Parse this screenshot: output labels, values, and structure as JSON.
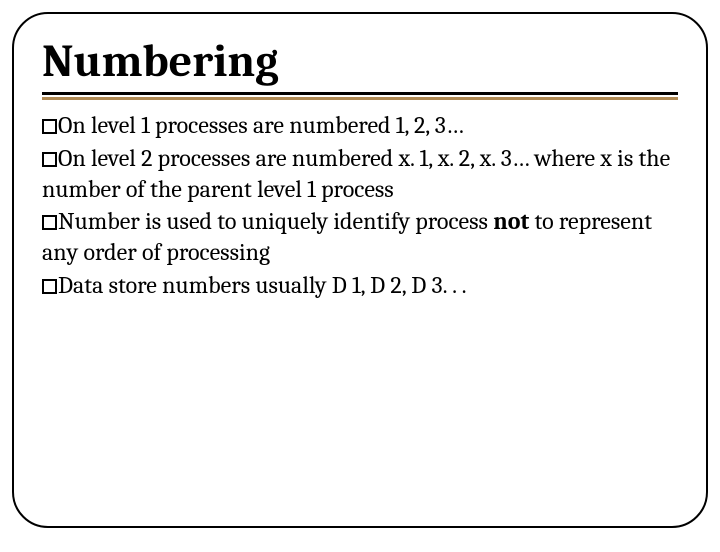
{
  "slide": {
    "title": "Numbering",
    "bullets": {
      "b1": "On level 1 processes are numbered 1, 2, 3…",
      "b2": "On level 2 processes are numbered x. 1, x. 2, x. 3… where x is the number of the parent level 1 process",
      "b3_pre": "Number is used to uniquely identify process ",
      "b3_bold": "not",
      "b3_post": " to represent any order of processing",
      "b4": "Data store numbers usually D 1, D 2, D 3. . ."
    }
  }
}
